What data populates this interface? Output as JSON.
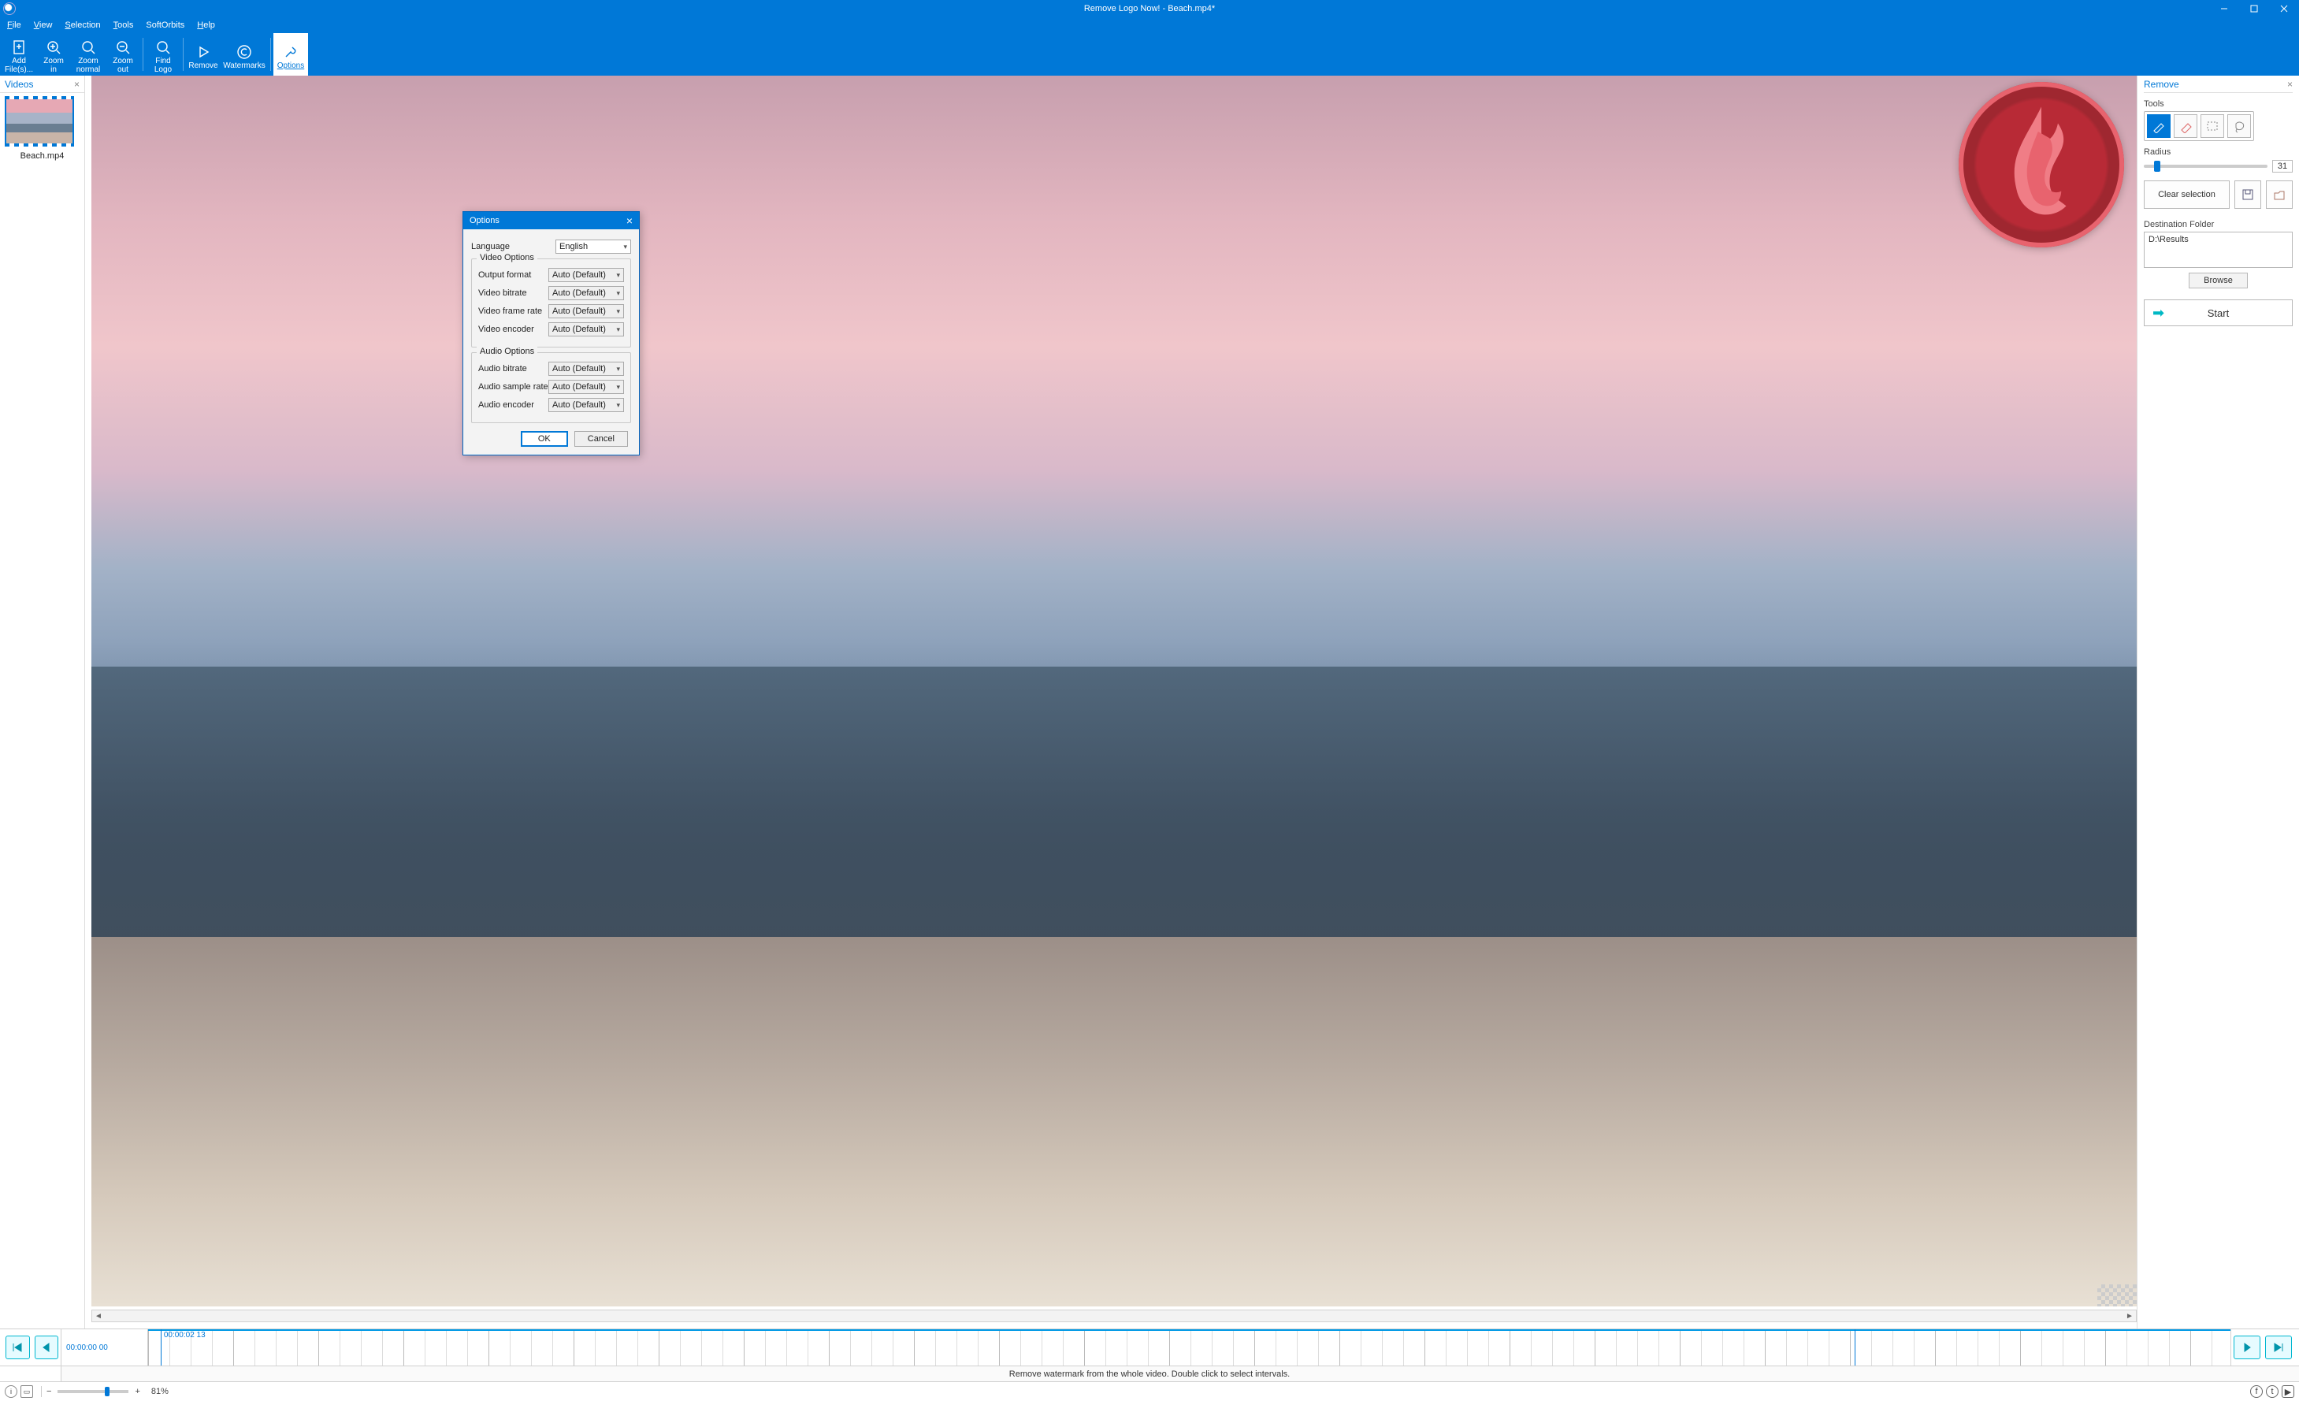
{
  "window": {
    "title": "Remove Logo Now! - Beach.mp4*"
  },
  "menus": [
    "File",
    "View",
    "Selection",
    "Tools",
    "SoftOrbits",
    "Help"
  ],
  "toolbar": [
    {
      "id": "add-files",
      "label": "Add\nFile(s)..."
    },
    {
      "id": "zoom-in",
      "label": "Zoom\nin"
    },
    {
      "id": "zoom-normal",
      "label": "Zoom\nnormal"
    },
    {
      "id": "zoom-out",
      "label": "Zoom\nout"
    },
    {
      "id": "find-logo",
      "label": "Find\nLogo"
    },
    {
      "id": "remove",
      "label": "Remove"
    },
    {
      "id": "watermarks",
      "label": "Watermarks"
    },
    {
      "id": "options",
      "label": "Options",
      "active": true
    }
  ],
  "videos_panel": {
    "title": "Videos",
    "items": [
      {
        "caption": "Beach.mp4"
      }
    ]
  },
  "remove_panel": {
    "title": "Remove",
    "tools_label": "Tools",
    "radius_label": "Radius",
    "radius_value": "31",
    "clear_label": "Clear selection",
    "dest_label": "Destination Folder",
    "dest_path": "D:\\Results",
    "browse_label": "Browse",
    "start_label": "Start"
  },
  "options_dialog": {
    "title": "Options",
    "language_label": "Language",
    "language_value": "English",
    "video_legend": "Video Options",
    "video_rows": [
      {
        "label": "Output format",
        "value": "Auto (Default)"
      },
      {
        "label": "Video bitrate",
        "value": "Auto (Default)"
      },
      {
        "label": "Video frame rate",
        "value": "Auto (Default)"
      },
      {
        "label": "Video encoder",
        "value": "Auto (Default)"
      }
    ],
    "audio_legend": "Audio Options",
    "audio_rows": [
      {
        "label": "Audio bitrate",
        "value": "Auto (Default)"
      },
      {
        "label": "Audio sample rate",
        "value": "Auto (Default)"
      },
      {
        "label": "Audio encoder",
        "value": "Auto (Default)"
      }
    ],
    "ok_label": "OK",
    "cancel_label": "Cancel"
  },
  "timeline": {
    "current_tc": "00:00:02 13",
    "start_tc": "00:00:00 00",
    "hint": "Remove watermark from the whole video. Double click to select intervals."
  },
  "statusbar": {
    "zoom_pct": "81%"
  }
}
